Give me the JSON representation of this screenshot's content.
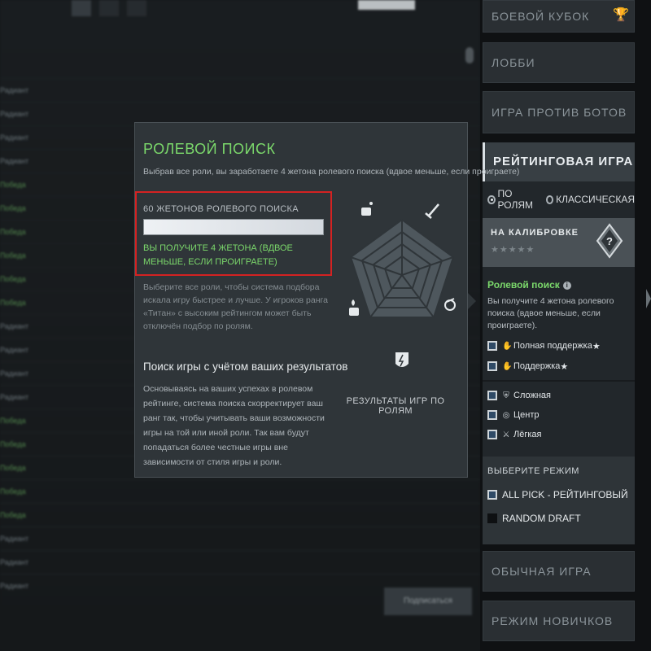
{
  "background": {
    "rows": [
      {
        "name": "Радиант",
        "c2": "",
        "c3": "",
        "c4": "",
        "green": false
      },
      {
        "name": "Радиант",
        "c2": "",
        "c3": "",
        "c4": "",
        "green": false
      },
      {
        "name": "Радиант",
        "c2": "",
        "c3": "",
        "c4": "",
        "green": false
      },
      {
        "name": "Радиант",
        "c2": "",
        "c3": "",
        "c4": "",
        "green": false
      },
      {
        "name": "Победа",
        "c2": "",
        "c3": "",
        "c4": "",
        "green": true
      },
      {
        "name": "Победа",
        "c2": "",
        "c3": "",
        "c4": "",
        "green": true
      },
      {
        "name": "Победа",
        "c2": "",
        "c3": "",
        "c4": "",
        "green": true
      },
      {
        "name": "Победа",
        "c2": "",
        "c3": "",
        "c4": "",
        "green": true
      },
      {
        "name": "Победа",
        "c2": "",
        "c3": "",
        "c4": "",
        "green": true
      },
      {
        "name": "Победа",
        "c2": "",
        "c3": "",
        "c4": "",
        "green": true
      },
      {
        "name": "Радиант",
        "c2": "",
        "c3": "",
        "c4": "",
        "green": false
      },
      {
        "name": "Радиант",
        "c2": "",
        "c3": "",
        "c4": "",
        "green": false
      },
      {
        "name": "Радиант",
        "c2": "",
        "c3": "",
        "c4": "",
        "green": false
      },
      {
        "name": "Радиант",
        "c2": "",
        "c3": "",
        "c4": "",
        "green": false
      },
      {
        "name": "Победа",
        "c2": "",
        "c3": "",
        "c4": "",
        "green": true
      },
      {
        "name": "Победа",
        "c2": "",
        "c3": "",
        "c4": "",
        "green": true
      },
      {
        "name": "Победа",
        "c2": "",
        "c3": "",
        "c4": "",
        "green": true
      },
      {
        "name": "Победа",
        "c2": "",
        "c3": "",
        "c4": "",
        "green": true
      },
      {
        "name": "Победа",
        "c2": "",
        "c3": "",
        "c4": "",
        "green": true
      },
      {
        "name": "Радиант",
        "c2": "",
        "c3": "",
        "c4": "",
        "green": false
      },
      {
        "name": "Радиант",
        "c2": "",
        "c3": "",
        "c4": "",
        "green": false
      },
      {
        "name": "Радиант",
        "c2": "",
        "c3": "",
        "c4": "",
        "green": false
      }
    ],
    "find_button": "Подписаться"
  },
  "right_panel": {
    "modes_top": [
      "БОЕВОЙ КУБОК",
      "ЛОББИ",
      "ИГРА ПРОТИВ БОТОВ"
    ],
    "ranked": {
      "title": "РЕЙТИНГОВАЯ ИГРА",
      "radio_by_roles": "ПО РОЛЯМ",
      "radio_classic": "КЛАССИЧЕСКАЯ",
      "calibration_title": "НА КАЛИБРОВКЕ",
      "calibration_stars": "★★★★★",
      "calibration_badge": "?",
      "role_search_title": "Ролевой поиск",
      "role_search_info": "i",
      "role_search_desc": "Вы получите 4 жетона ролевого поиска (вдвое меньше, если проиграете).",
      "roles": [
        {
          "icon": "hand-icon",
          "glyph": "✋",
          "label": "Полная поддержка",
          "star": "★"
        },
        {
          "icon": "hand-icon",
          "glyph": "✋",
          "label": "Поддержка",
          "star": "★"
        },
        {
          "icon": "shield-icon",
          "glyph": "⛨",
          "label": "Сложная",
          "star": ""
        },
        {
          "icon": "target-icon",
          "glyph": "◎",
          "label": "Центр",
          "star": ""
        },
        {
          "icon": "sword-icon",
          "glyph": "⚔",
          "label": "Лёгкая",
          "star": ""
        }
      ],
      "select_mode_title": "ВЫБЕРИТЕ РЕЖИМ",
      "mode_options": [
        "ALL PICK - РЕЙТИНГОВЫЙ",
        "RANDOM DRAFT"
      ]
    },
    "modes_bottom": [
      "ОБЫЧНАЯ ИГРА",
      "РЕЖИМ НОВИЧКОВ"
    ]
  },
  "popup": {
    "title": "РОЛЕВОЙ ПОИСК",
    "subtitle": "Выбрав все роли, вы заработаете 4 жетона ролевого поиска (вдвое меньше, если проиграете)",
    "tokens_label": "60 ЖЕТОНОВ РОЛЕВОГО ПОИСКА",
    "tokens_progress": 1.0,
    "tokens_gain": "ВЫ ПОЛУЧИТЕ 4 ЖЕТОНА (ВДВОЕ МЕНЬШЕ, ЕСЛИ ПРОИГРАЕТЕ)",
    "help_text": "Выберите все роли, чтобы система подбора искала игру быстрее и лучше. У игроков ранга «Титан» с высоким рейтингом может быть отключён подбор по ролям.",
    "section_title": "Поиск игры с учётом ваших результатов",
    "section_body": "Основываясь на ваших успехах в ролевом рейтинге, система поиска скорректирует ваш ранг так, чтобы учитывать ваши возможности игры на той или иной роли. Так вам будут попадаться более честные игры вне зависимости от стиля игры и роли.",
    "radar_caption": "РЕЗУЛЬТАТЫ ИГР ПО РОЛЯМ"
  }
}
